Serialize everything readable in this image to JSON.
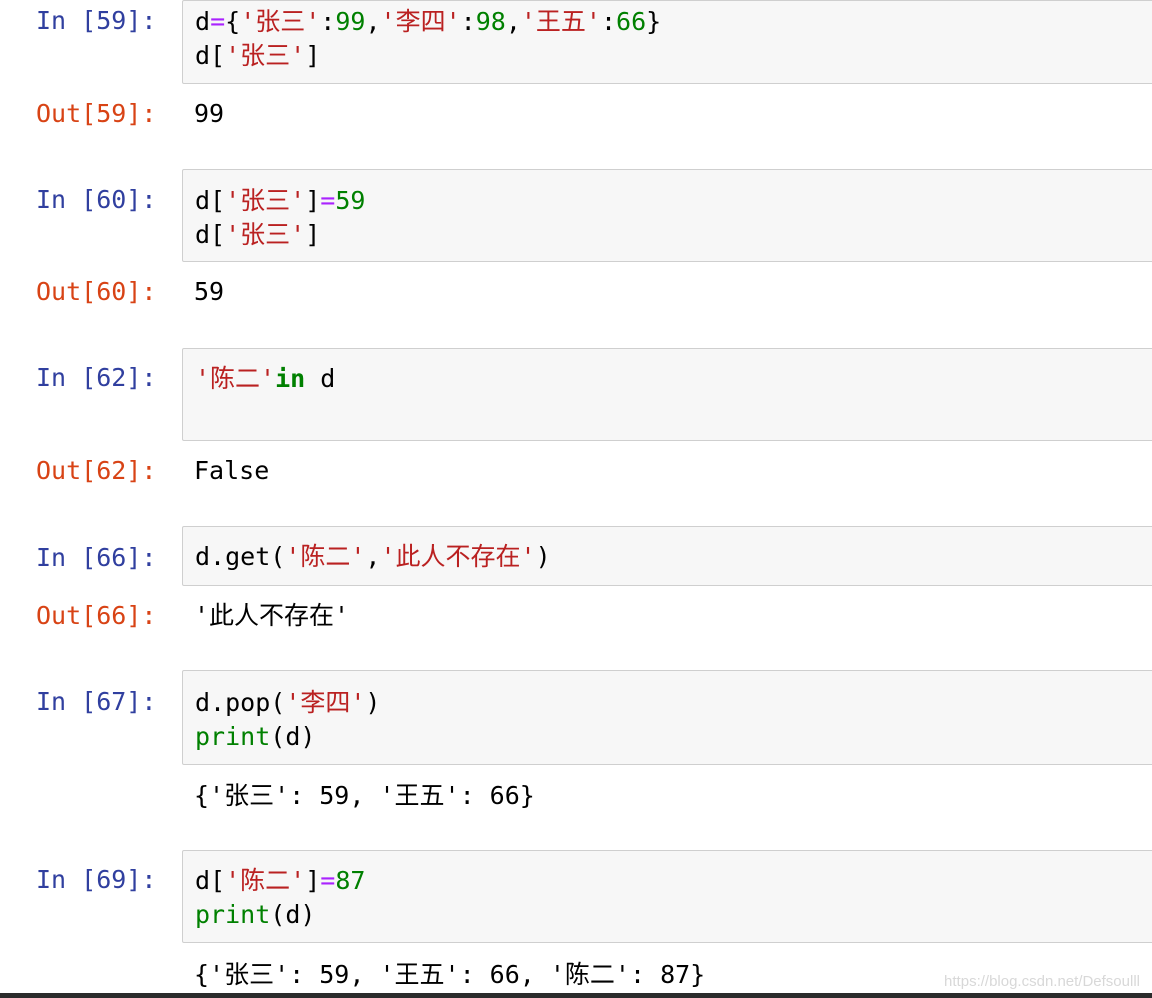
{
  "cells": [
    {
      "in_prompt": "In [59]:",
      "lines": [
        [
          {
            "t": "d"
          },
          {
            "t": "=",
            "c": "op"
          },
          {
            "t": "{"
          },
          {
            "t": "'张三'",
            "c": "str"
          },
          {
            "t": ":"
          },
          {
            "t": "99",
            "c": "num"
          },
          {
            "t": ","
          },
          {
            "t": "'李四'",
            "c": "str"
          },
          {
            "t": ":"
          },
          {
            "t": "98",
            "c": "num"
          },
          {
            "t": ","
          },
          {
            "t": "'王五'",
            "c": "str"
          },
          {
            "t": ":"
          },
          {
            "t": "66",
            "c": "num"
          },
          {
            "t": "}"
          }
        ],
        [
          {
            "t": "d["
          },
          {
            "t": "'张三'",
            "c": "str"
          },
          {
            "t": "]"
          }
        ]
      ],
      "out_prompt": "Out[59]:",
      "output": "99"
    },
    {
      "in_prompt": "In [60]:",
      "lines": [
        [
          {
            "t": "d["
          },
          {
            "t": "'张三'",
            "c": "str"
          },
          {
            "t": "]"
          },
          {
            "t": "=",
            "c": "op"
          },
          {
            "t": "59",
            "c": "num"
          }
        ],
        [
          {
            "t": "d["
          },
          {
            "t": "'张三'",
            "c": "str"
          },
          {
            "t": "]"
          }
        ]
      ],
      "out_prompt": "Out[60]:",
      "output": "59"
    },
    {
      "in_prompt": "In [62]:",
      "lines": [
        [
          {
            "t": "'陈二'",
            "c": "str"
          },
          {
            "t": "in",
            "c": "kw"
          },
          {
            "t": " d"
          }
        ],
        [
          {
            "t": ""
          }
        ]
      ],
      "out_prompt": "Out[62]:",
      "output": "False"
    },
    {
      "in_prompt": "In [66]:",
      "lines": [
        [
          {
            "t": "d.get("
          },
          {
            "t": "'陈二'",
            "c": "str"
          },
          {
            "t": ","
          },
          {
            "t": "'此人不存在'",
            "c": "str"
          },
          {
            "t": ")"
          }
        ]
      ],
      "out_prompt": "Out[66]:",
      "output": "'此人不存在'"
    },
    {
      "in_prompt": "In [67]:",
      "lines": [
        [
          {
            "t": "d.pop("
          },
          {
            "t": "'李四'",
            "c": "str"
          },
          {
            "t": ")"
          }
        ],
        [
          {
            "t": "print",
            "c": "bi"
          },
          {
            "t": "(d)"
          }
        ]
      ],
      "out_prompt": "",
      "output": "{'张三': 59, '王五': 66}"
    },
    {
      "in_prompt": "In [69]:",
      "lines": [
        [
          {
            "t": "d["
          },
          {
            "t": "'陈二'",
            "c": "str"
          },
          {
            "t": "]"
          },
          {
            "t": "=",
            "c": "op"
          },
          {
            "t": "87",
            "c": "num"
          }
        ],
        [
          {
            "t": "print",
            "c": "bi"
          },
          {
            "t": "(d)"
          }
        ]
      ],
      "out_prompt": "",
      "output": "{'张三': 59, '王五': 66, '陈二': 87}"
    }
  ],
  "watermark": "https://blog.csdn.net/Defsoulll"
}
